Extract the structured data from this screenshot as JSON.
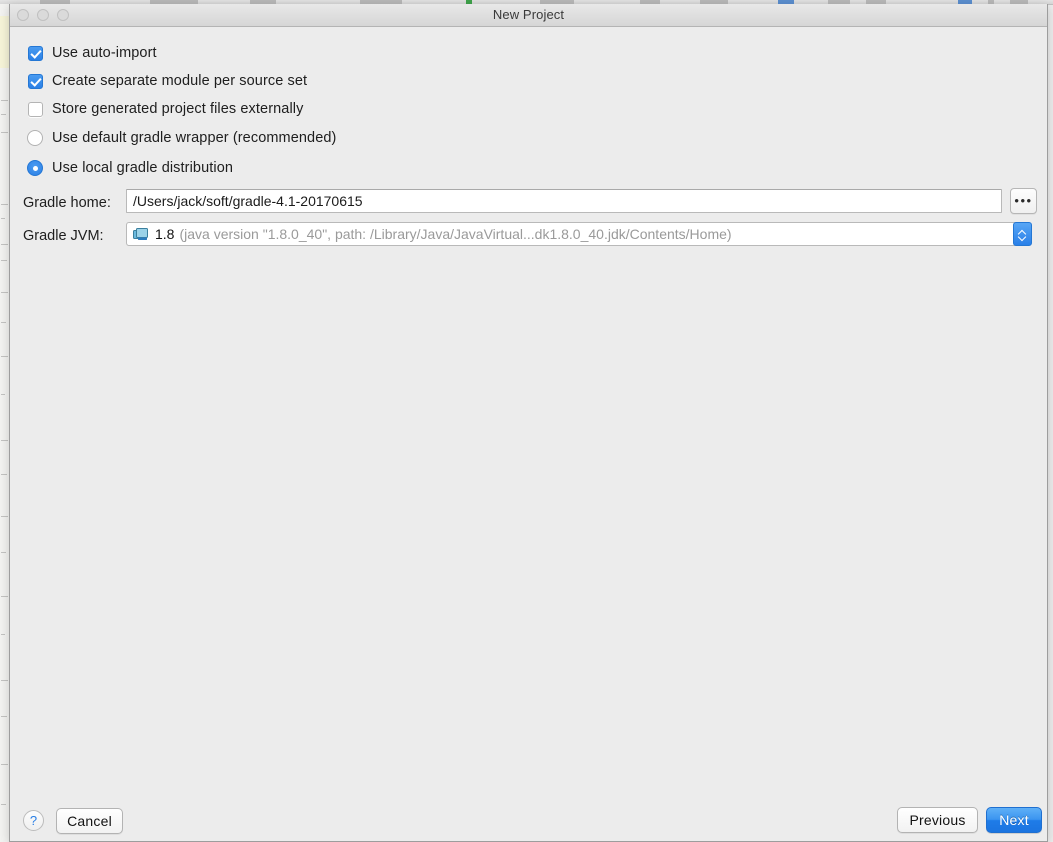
{
  "window": {
    "title": "New Project",
    "traffic_lights": [
      "close",
      "minimize",
      "zoom"
    ]
  },
  "options": {
    "checkboxes": [
      {
        "label": "Use auto-import",
        "checked": true
      },
      {
        "label": "Create separate module per source set",
        "checked": true
      },
      {
        "label": "Store generated project files externally",
        "checked": false
      }
    ],
    "radios": [
      {
        "label": "Use default gradle wrapper (recommended)",
        "selected": false
      },
      {
        "label": "Use local gradle distribution",
        "selected": true
      }
    ]
  },
  "fields": {
    "gradle_home": {
      "label": "Gradle home:",
      "value": "/Users/jack/soft/gradle-4.1-20170615",
      "placeholder": "",
      "browse_label": "•••"
    },
    "gradle_jvm": {
      "label": "Gradle JVM:",
      "icon": "jdk-icon",
      "version": "1.8",
      "detail": "(java version \"1.8.0_40\", path: /Library/Java/JavaVirtual...dk1.8.0_40.jdk/Contents/Home)",
      "full_value": "1.8 (java version \"1.8.0_40\", path: /Library/Java/JavaVirtual...dk1.8.0_40.jdk/Contents/Home)"
    }
  },
  "footer": {
    "help_label": "?",
    "cancel_label": "Cancel",
    "previous_label": "Previous",
    "next_label": "Next"
  },
  "colors": {
    "accent": "#2a80e8",
    "default_button": "#3a94f0",
    "dialog_bg": "#ececec",
    "titlebar_bg": "#dcdcdc",
    "field_border": "#b9b9b9",
    "text": "#1e1e1e",
    "muted_text": "#9a9a9a"
  }
}
